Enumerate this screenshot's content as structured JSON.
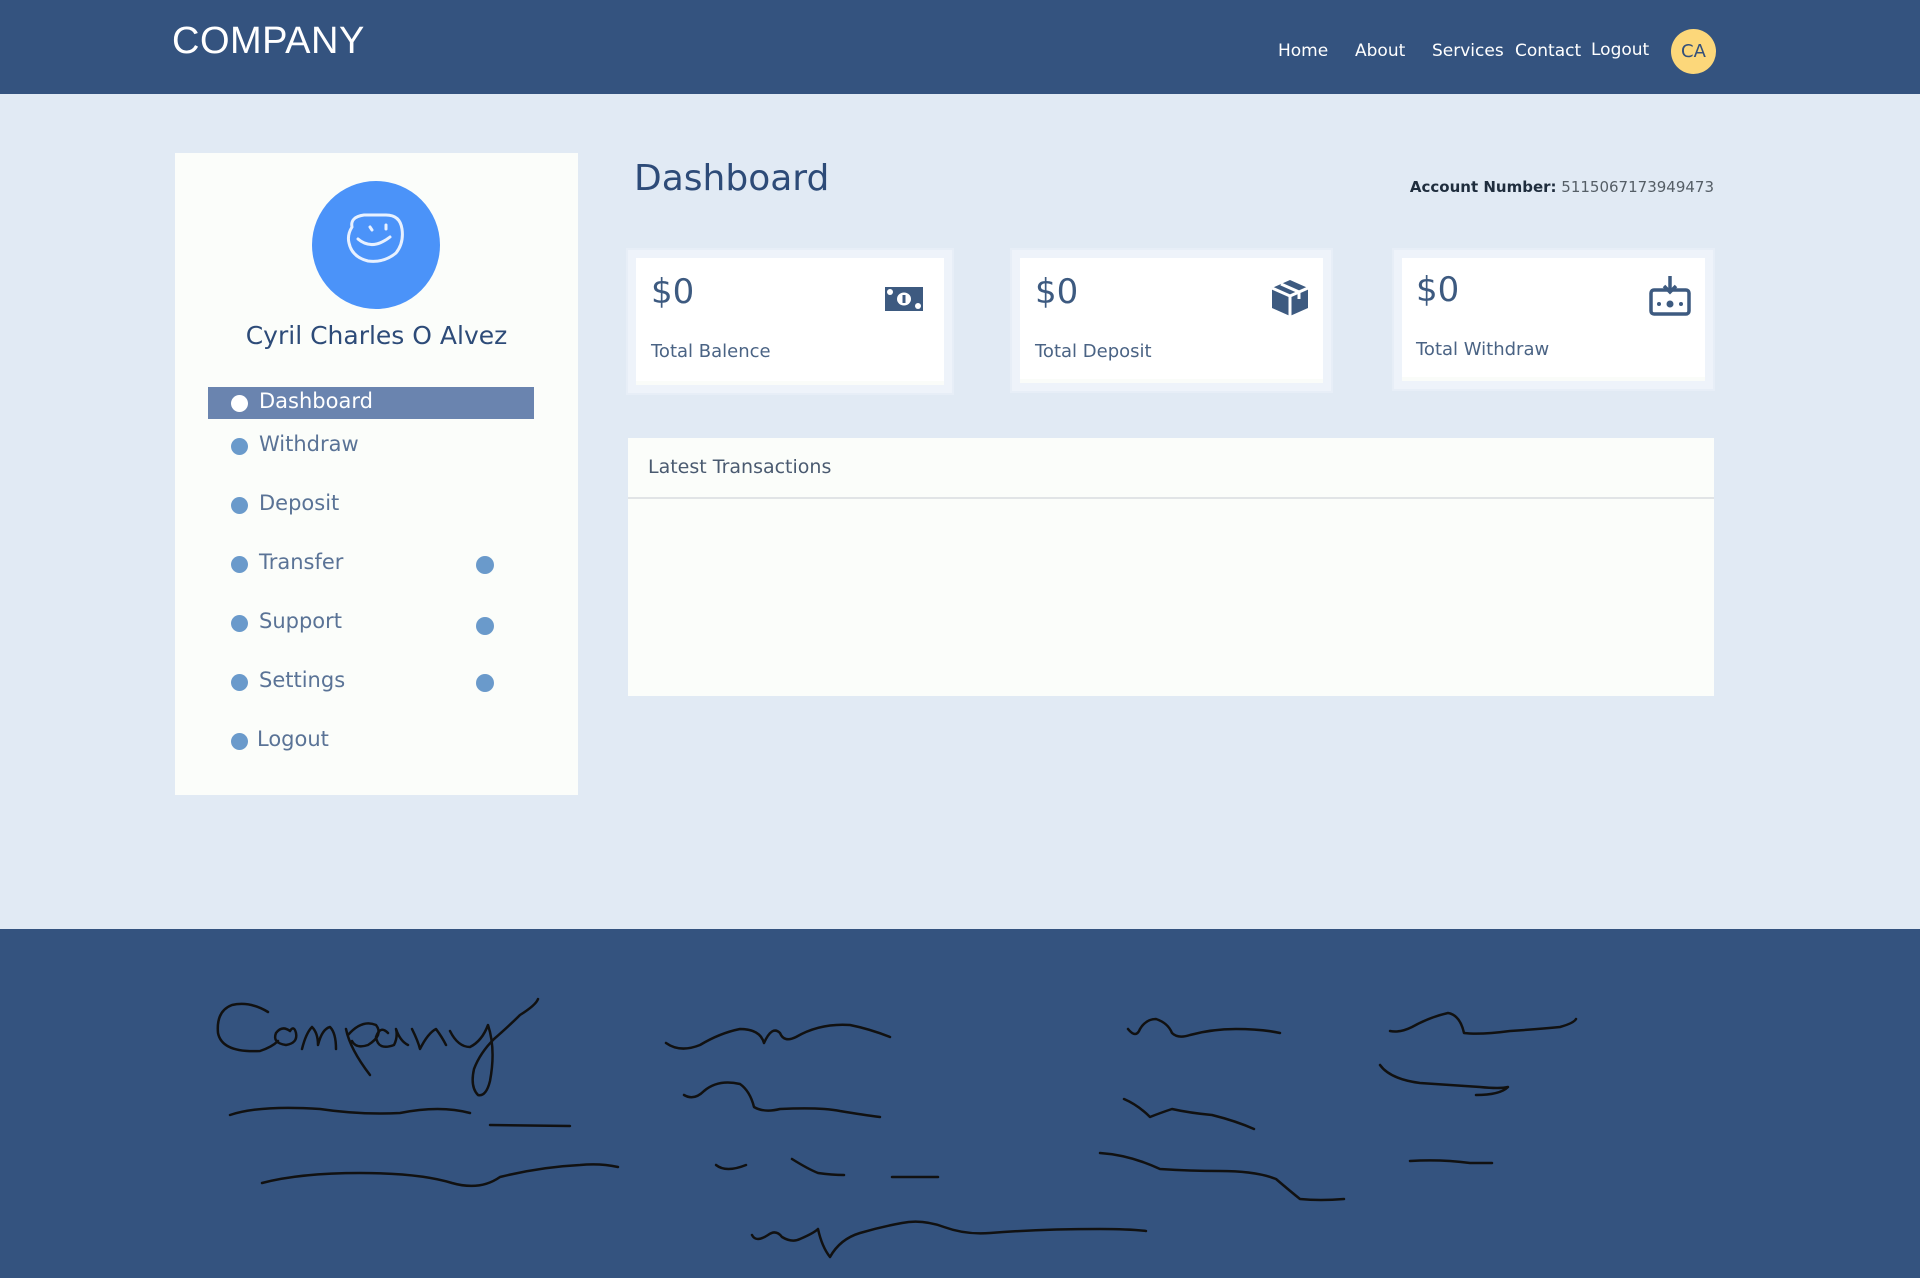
{
  "header": {
    "brand": "COMPANY",
    "nav": [
      "Home",
      "About",
      "Services",
      "Contact",
      "Logout"
    ],
    "avatar_initials": "CA",
    "colors": {
      "bar": "#34537f",
      "avatar": "#fcd77a"
    }
  },
  "sidebar": {
    "user_name": "Cyril Charles O Alvez",
    "profile_icon": "smiley-face-icon",
    "items": [
      {
        "label": "Dashboard",
        "active": true,
        "badge": false
      },
      {
        "label": "Withdraw",
        "active": false,
        "badge": false
      },
      {
        "label": "Deposit",
        "active": false,
        "badge": false
      },
      {
        "label": "Transfer",
        "active": false,
        "badge": true
      },
      {
        "label": "Support",
        "active": false,
        "badge": true
      },
      {
        "label": "Settings",
        "active": false,
        "badge": true
      },
      {
        "label": "Logout",
        "active": false,
        "badge": false
      }
    ]
  },
  "main": {
    "title": "Dashboard",
    "account_label": "Account Number:",
    "account_number": "5115067173949473",
    "cards": [
      {
        "amount": "$0",
        "label": "Total Balence",
        "icon": "money-bill-icon"
      },
      {
        "amount": "$0",
        "label": "Total Deposit",
        "icon": "box-icon"
      },
      {
        "amount": "$0",
        "label": "Total Withdraw",
        "icon": "withdraw-icon"
      }
    ],
    "transactions_title": "Latest Transactions"
  },
  "footer": {
    "handwriting_heading": "Company"
  }
}
